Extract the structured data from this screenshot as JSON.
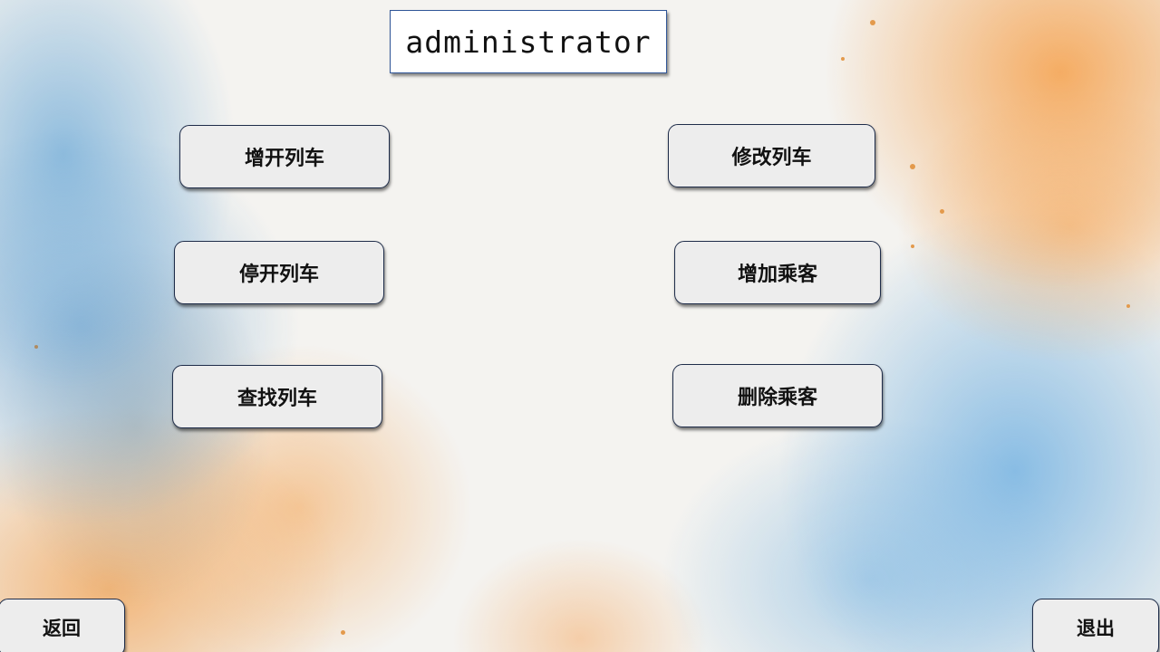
{
  "header": {
    "title": "administrator"
  },
  "actions": {
    "add_train": "增开列车",
    "stop_train": "停开列车",
    "find_train": "查找列车",
    "modify_train": "修改列车",
    "add_passenger": "增加乘客",
    "delete_passenger": "删除乘客"
  },
  "footer": {
    "back_label": "返回",
    "quit_label": "退出"
  }
}
